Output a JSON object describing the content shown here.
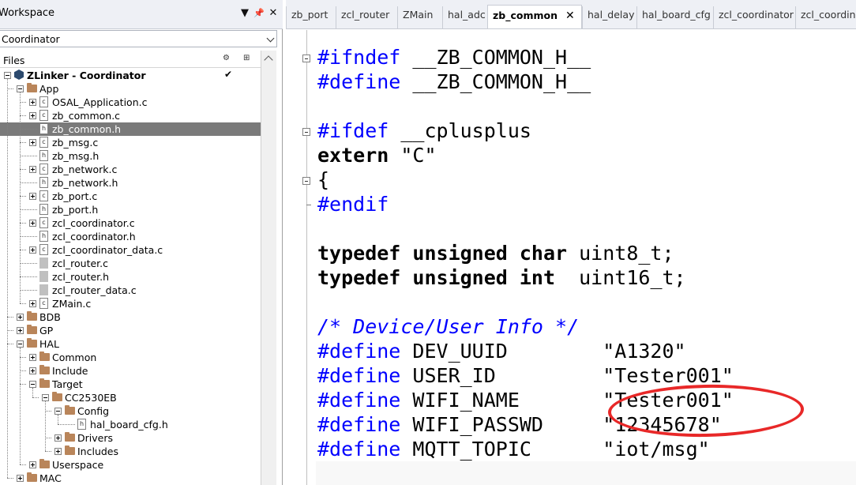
{
  "workspace": {
    "title": "Workspace",
    "buttons": [
      "▼",
      "📌",
      "✕"
    ],
    "config_selected": "Coordinator",
    "files_header": "Files",
    "header_icons": [
      "⚙",
      "⊞"
    ]
  },
  "tree": [
    {
      "label": "ZLinker - Coordinator",
      "type": "project",
      "depth": 0,
      "expander": "minus",
      "bold": true,
      "check": "✔"
    },
    {
      "label": "App",
      "type": "folder",
      "depth": 1,
      "expander": "minus"
    },
    {
      "label": "OSAL_Application.c",
      "type": "c",
      "depth": 2,
      "expander": "plus"
    },
    {
      "label": "zb_common.c",
      "type": "c",
      "depth": 2,
      "expander": "plus"
    },
    {
      "label": "zb_common.h",
      "type": "h",
      "depth": 2,
      "expander": "",
      "selected": true
    },
    {
      "label": "zb_msg.c",
      "type": "c",
      "depth": 2,
      "expander": "plus"
    },
    {
      "label": "zb_msg.h",
      "type": "h",
      "depth": 2,
      "expander": ""
    },
    {
      "label": "zb_network.c",
      "type": "c",
      "depth": 2,
      "expander": "plus"
    },
    {
      "label": "zb_network.h",
      "type": "h",
      "depth": 2,
      "expander": ""
    },
    {
      "label": "zb_port.c",
      "type": "c",
      "depth": 2,
      "expander": "plus"
    },
    {
      "label": "zb_port.h",
      "type": "h",
      "depth": 2,
      "expander": ""
    },
    {
      "label": "zcl_coordinator.c",
      "type": "c",
      "depth": 2,
      "expander": "plus"
    },
    {
      "label": "zcl_coordinator.h",
      "type": "h",
      "depth": 2,
      "expander": ""
    },
    {
      "label": "zcl_coordinator_data.c",
      "type": "c",
      "depth": 2,
      "expander": "plus"
    },
    {
      "label": "zcl_router.c",
      "type": "grey",
      "depth": 2,
      "expander": ""
    },
    {
      "label": "zcl_router.h",
      "type": "grey",
      "depth": 2,
      "expander": ""
    },
    {
      "label": "zcl_router_data.c",
      "type": "grey",
      "depth": 2,
      "expander": ""
    },
    {
      "label": "ZMain.c",
      "type": "c",
      "depth": 2,
      "expander": "plus"
    },
    {
      "label": "BDB",
      "type": "folder",
      "depth": 1,
      "expander": "plus"
    },
    {
      "label": "GP",
      "type": "folder",
      "depth": 1,
      "expander": "plus"
    },
    {
      "label": "HAL",
      "type": "folder",
      "depth": 1,
      "expander": "minus"
    },
    {
      "label": "Common",
      "type": "folder",
      "depth": 2,
      "expander": "plus"
    },
    {
      "label": "Include",
      "type": "folder",
      "depth": 2,
      "expander": "plus"
    },
    {
      "label": "Target",
      "type": "folder",
      "depth": 2,
      "expander": "minus"
    },
    {
      "label": "CC2530EB",
      "type": "folder",
      "depth": 3,
      "expander": "minus"
    },
    {
      "label": "Config",
      "type": "folder",
      "depth": 4,
      "expander": "minus"
    },
    {
      "label": "hal_board_cfg.h",
      "type": "h",
      "depth": 5,
      "expander": ""
    },
    {
      "label": "Drivers",
      "type": "folder",
      "depth": 4,
      "expander": "plus"
    },
    {
      "label": "Includes",
      "type": "folder",
      "depth": 4,
      "expander": "plus"
    },
    {
      "label": "Userspace",
      "type": "folder",
      "depth": 2,
      "expander": "plus"
    },
    {
      "label": "MAC",
      "type": "folder",
      "depth": 1,
      "expander": "plus"
    }
  ],
  "tabs": [
    {
      "label": "zb_port",
      "active": false
    },
    {
      "label": "zcl_router",
      "active": false
    },
    {
      "label": "ZMain",
      "active": false
    },
    {
      "label": "hal_adc",
      "active": false
    },
    {
      "label": "zb_common",
      "active": true
    },
    {
      "label": "hal_delay",
      "active": false
    },
    {
      "label": "hal_board_cfg",
      "active": false
    },
    {
      "label": "zcl_coordinator",
      "active": false
    },
    {
      "label": "zcl_coordinator",
      "active": false
    }
  ],
  "tab_close": "✕",
  "code": [
    [
      {
        "c": "pp",
        "t": "#ifndef"
      },
      {
        "c": "",
        "t": " __ZB_COMMON_H__"
      }
    ],
    [
      {
        "c": "pp",
        "t": "#define"
      },
      {
        "c": "",
        "t": " __ZB_COMMON_H__"
      }
    ],
    [],
    [
      {
        "c": "pp",
        "t": "#ifdef"
      },
      {
        "c": "",
        "t": " __cplusplus"
      }
    ],
    [
      {
        "c": "kw",
        "t": "extern"
      },
      {
        "c": "",
        "t": " \"C\""
      }
    ],
    [
      {
        "c": "",
        "t": "{"
      }
    ],
    [
      {
        "c": "pp",
        "t": "#endif"
      }
    ],
    [],
    [
      {
        "c": "kw",
        "t": "typedef unsigned char"
      },
      {
        "c": "",
        "t": " uint8_t;"
      }
    ],
    [
      {
        "c": "kw",
        "t": "typedef unsigned int"
      },
      {
        "c": "",
        "t": "  uint16_t;"
      }
    ],
    [],
    [
      {
        "c": "cm",
        "t": "/* Device/User Info */"
      }
    ],
    [
      {
        "c": "pp",
        "t": "#define"
      },
      {
        "c": "",
        "t": " DEV_UUID        \"A1320\""
      }
    ],
    [
      {
        "c": "pp",
        "t": "#define"
      },
      {
        "c": "",
        "t": " USER_ID         \"Tester001\""
      }
    ],
    [
      {
        "c": "pp",
        "t": "#define"
      },
      {
        "c": "",
        "t": " WIFI_NAME       \"Tester001\""
      }
    ],
    [
      {
        "c": "pp",
        "t": "#define"
      },
      {
        "c": "",
        "t": " WIFI_PASSWD     \"12345678\""
      }
    ],
    [
      {
        "c": "pp",
        "t": "#define"
      },
      {
        "c": "",
        "t": " MQTT_TOPIC      \"iot/msg\""
      }
    ]
  ],
  "colors": {
    "preprocessor": "#0000ff",
    "comment": "#0000ff",
    "selection": "#7a7a7a",
    "annotation": "#e82828"
  }
}
